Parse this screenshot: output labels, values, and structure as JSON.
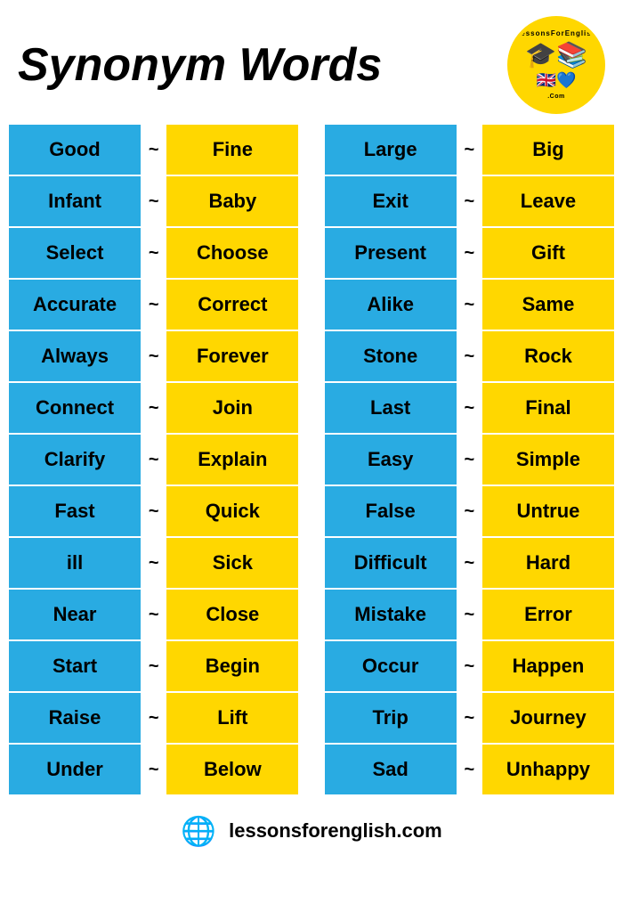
{
  "header": {
    "title": "Synonym Words",
    "logo_arc_top": "LessonsForEnglish",
    "logo_arc_bottom": ".Com"
  },
  "left_pairs": [
    {
      "word": "Good",
      "tilde": "~",
      "synonym": "Fine"
    },
    {
      "word": "Infant",
      "tilde": "~",
      "synonym": "Baby"
    },
    {
      "word": "Select",
      "tilde": "~",
      "synonym": "Choose"
    },
    {
      "word": "Accurate",
      "tilde": "~",
      "synonym": "Correct"
    },
    {
      "word": "Always",
      "tilde": "~",
      "synonym": "Forever"
    },
    {
      "word": "Connect",
      "tilde": "~",
      "synonym": "Join"
    },
    {
      "word": "Clarify",
      "tilde": "~",
      "synonym": "Explain"
    },
    {
      "word": "Fast",
      "tilde": "~",
      "synonym": "Quick"
    },
    {
      "word": "ill",
      "tilde": "~",
      "synonym": "Sick"
    },
    {
      "word": "Near",
      "tilde": "~",
      "synonym": "Close"
    },
    {
      "word": "Start",
      "tilde": "~",
      "synonym": "Begin"
    },
    {
      "word": "Raise",
      "tilde": "~",
      "synonym": "Lift"
    },
    {
      "word": "Under",
      "tilde": "~",
      "synonym": "Below"
    }
  ],
  "right_pairs": [
    {
      "word": "Large",
      "tilde": "~",
      "synonym": "Big"
    },
    {
      "word": "Exit",
      "tilde": "~",
      "synonym": "Leave"
    },
    {
      "word": "Present",
      "tilde": "~",
      "synonym": "Gift"
    },
    {
      "word": "Alike",
      "tilde": "~",
      "synonym": "Same"
    },
    {
      "word": "Stone",
      "tilde": "~",
      "synonym": "Rock"
    },
    {
      "word": "Last",
      "tilde": "~",
      "synonym": "Final"
    },
    {
      "word": "Easy",
      "tilde": "~",
      "synonym": "Simple"
    },
    {
      "word": "False",
      "tilde": "~",
      "synonym": "Untrue"
    },
    {
      "word": "Difficult",
      "tilde": "~",
      "synonym": "Hard"
    },
    {
      "word": "Mistake",
      "tilde": "~",
      "synonym": "Error"
    },
    {
      "word": "Occur",
      "tilde": "~",
      "synonym": "Happen"
    },
    {
      "word": "Trip",
      "tilde": "~",
      "synonym": "Journey"
    },
    {
      "word": "Sad",
      "tilde": "~",
      "synonym": "Unhappy"
    }
  ],
  "footer": {
    "url": "lessonsforenglish.com",
    "icon": "🌐"
  }
}
